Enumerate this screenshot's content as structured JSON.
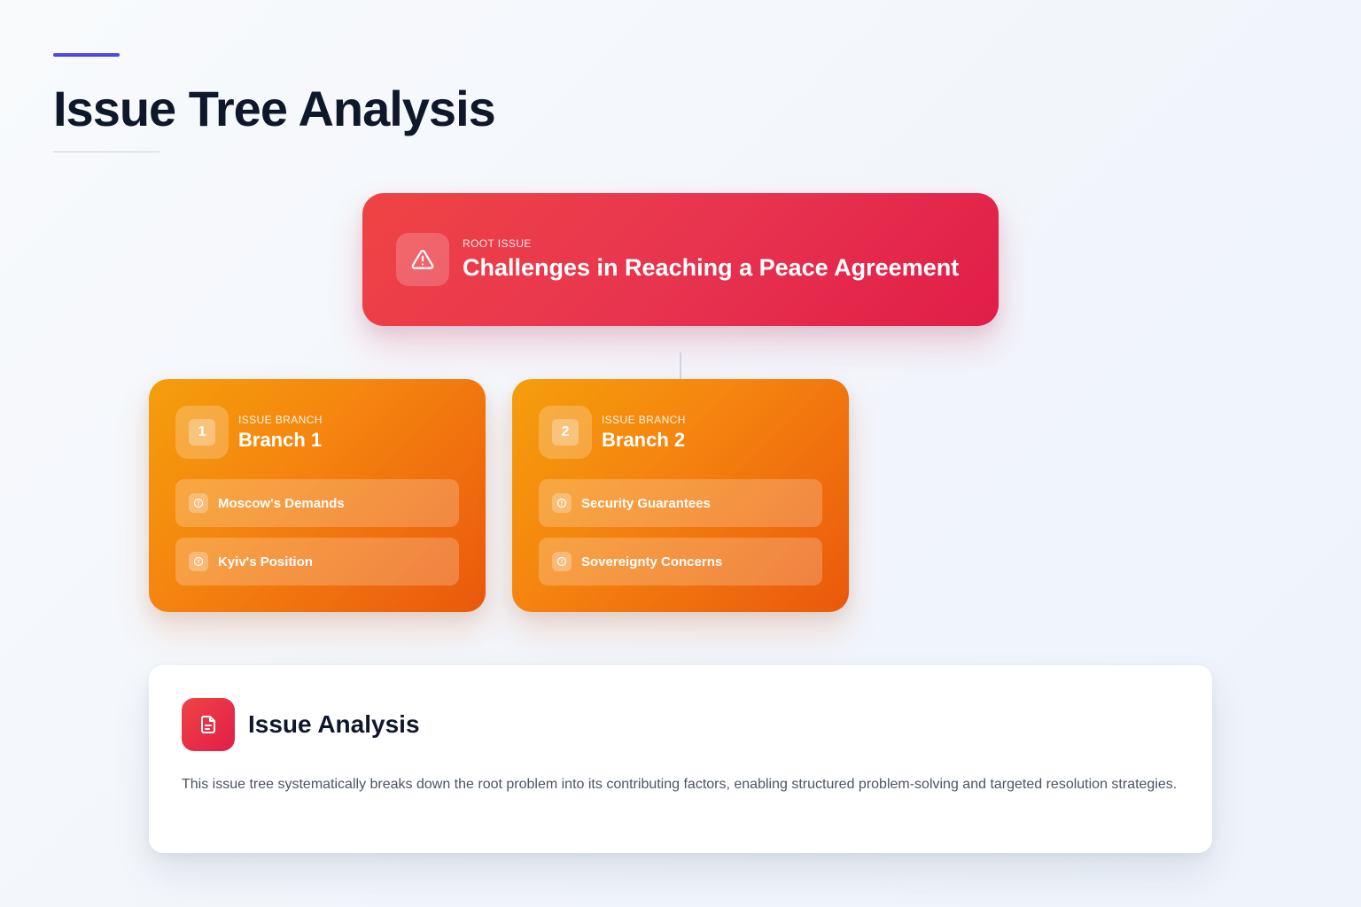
{
  "header": {
    "title": "Issue Tree Analysis"
  },
  "root": {
    "kicker": "ROOT ISSUE",
    "title": "Challenges in Reaching a Peace Agreement",
    "icon": "warning-triangle-icon"
  },
  "branches": [
    {
      "number": "1",
      "kicker": "ISSUE BRANCH",
      "title": "Branch 1",
      "items": [
        {
          "label": "Moscow's Demands",
          "icon": "info-circle-icon"
        },
        {
          "label": "Kyiv's Position",
          "icon": "info-circle-icon"
        }
      ]
    },
    {
      "number": "2",
      "kicker": "ISSUE BRANCH",
      "title": "Branch 2",
      "items": [
        {
          "label": "Security Guarantees",
          "icon": "info-circle-icon"
        },
        {
          "label": "Sovereignty Concerns",
          "icon": "info-circle-icon"
        }
      ]
    }
  ],
  "analysis": {
    "icon": "document-icon",
    "title": "Issue Analysis",
    "description": "This issue tree systematically breaks down the root problem into its contributing factors, enabling structured problem-solving and targeted resolution strategies."
  },
  "colors": {
    "accent": "#4f46e5",
    "root_start": "#ef4444",
    "root_end": "#e11d48",
    "branch_start": "#f59e0b",
    "branch_end": "#ea580c",
    "title_text": "#0f172a",
    "body_text": "#4b5563"
  }
}
